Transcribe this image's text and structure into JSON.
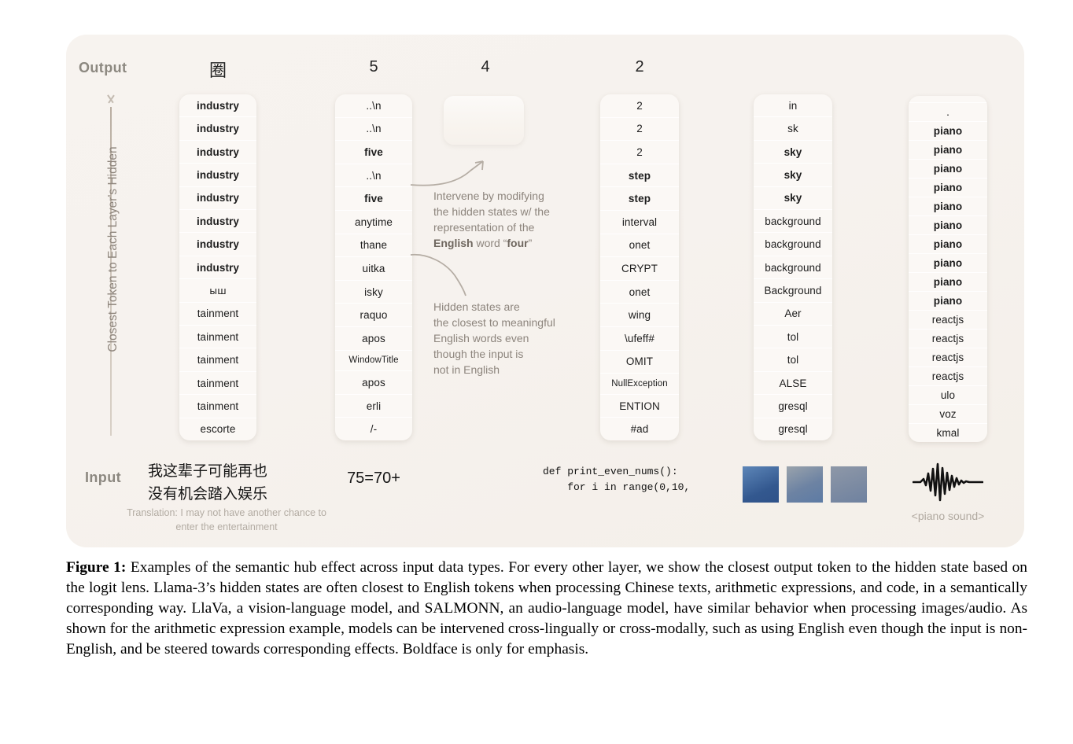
{
  "figure": {
    "output_row_label": "Output",
    "input_row_label": "Input",
    "y_axis_label": "Closest Token to Each Layer's Hidden",
    "columns": [
      {
        "id": "chinese",
        "output_header": "圈",
        "tokens": [
          {
            "text": "industry",
            "bold": true
          },
          {
            "text": "industry",
            "bold": true
          },
          {
            "text": "industry",
            "bold": true
          },
          {
            "text": "industry",
            "bold": true
          },
          {
            "text": "industry",
            "bold": true
          },
          {
            "text": "industry",
            "bold": true
          },
          {
            "text": "industry",
            "bold": true
          },
          {
            "text": "industry",
            "bold": true
          },
          {
            "text": "ыш",
            "bold": false
          },
          {
            "text": "tainment",
            "bold": false
          },
          {
            "text": "tainment",
            "bold": false
          },
          {
            "text": "tainment",
            "bold": false
          },
          {
            "text": "tainment",
            "bold": false
          },
          {
            "text": "tainment",
            "bold": false
          },
          {
            "text": "escorte",
            "bold": false
          }
        ],
        "input_text": "我这辈子可能再也\n没有机会踏入娱乐",
        "input_translation": "Translation: I may not have another chance to enter the entertainment"
      },
      {
        "id": "arithmetic",
        "output_header": "5",
        "tokens": [
          {
            "text": "..\\n",
            "bold": false
          },
          {
            "text": "..\\n",
            "bold": false
          },
          {
            "text": "five",
            "bold": true
          },
          {
            "text": "..\\n",
            "bold": false
          },
          {
            "text": "five",
            "bold": true
          },
          {
            "text": "anytime",
            "bold": false
          },
          {
            "text": "thane",
            "bold": false
          },
          {
            "text": "uitka",
            "bold": false
          },
          {
            "text": "isky",
            "bold": false
          },
          {
            "text": "raquo",
            "bold": false
          },
          {
            "text": "apos",
            "bold": false
          },
          {
            "text": "WindowTitle",
            "bold": false
          },
          {
            "text": "apos",
            "bold": false
          },
          {
            "text": "erli",
            "bold": false
          },
          {
            "text": "/-",
            "bold": false
          }
        ],
        "input_text": "75=70+"
      },
      {
        "id": "intervened",
        "output_header": "4",
        "tokens": [],
        "input_text": ""
      },
      {
        "id": "code",
        "output_header": "2",
        "tokens": [
          {
            "text": "2",
            "bold": false
          },
          {
            "text": "2",
            "bold": false
          },
          {
            "text": "2",
            "bold": false
          },
          {
            "text": "step",
            "bold": true
          },
          {
            "text": "step",
            "bold": true
          },
          {
            "text": "interval",
            "bold": false
          },
          {
            "text": "onet",
            "bold": false
          },
          {
            "text": "CRYPT",
            "bold": false
          },
          {
            "text": "onet",
            "bold": false
          },
          {
            "text": "wing",
            "bold": false
          },
          {
            "text": "\\ufeff#",
            "bold": false
          },
          {
            "text": "OMIT",
            "bold": false
          },
          {
            "text": "NullException",
            "bold": false
          },
          {
            "text": "ENTION",
            "bold": false
          },
          {
            "text": "#ad",
            "bold": false
          }
        ],
        "input_text": "def print_even_nums():\n    for i in range(0,10,"
      },
      {
        "id": "image",
        "output_header": "",
        "tokens": [
          {
            "text": "in",
            "bold": false
          },
          {
            "text": "sk",
            "bold": false
          },
          {
            "text": "sky",
            "bold": true
          },
          {
            "text": "sky",
            "bold": true
          },
          {
            "text": "sky",
            "bold": true
          },
          {
            "text": "background",
            "bold": false
          },
          {
            "text": "background",
            "bold": false
          },
          {
            "text": "background",
            "bold": false
          },
          {
            "text": "Background",
            "bold": false
          },
          {
            "text": "Aer",
            "bold": false
          },
          {
            "text": "tol",
            "bold": false
          },
          {
            "text": "tol",
            "bold": false
          },
          {
            "text": "ALSE",
            "bold": false
          },
          {
            "text": "gresql",
            "bold": false
          },
          {
            "text": "gresql",
            "bold": false
          }
        ],
        "input_text": ""
      },
      {
        "id": "audio",
        "output_header": "",
        "tokens": [
          {
            "text": "",
            "bold": false
          },
          {
            "text": ".",
            "bold": false
          },
          {
            "text": "piano",
            "bold": true
          },
          {
            "text": "piano",
            "bold": true
          },
          {
            "text": "piano",
            "bold": true
          },
          {
            "text": "piano",
            "bold": true
          },
          {
            "text": "piano",
            "bold": true
          },
          {
            "text": "piano",
            "bold": true
          },
          {
            "text": "piano",
            "bold": true
          },
          {
            "text": "piano",
            "bold": true
          },
          {
            "text": "piano",
            "bold": true
          },
          {
            "text": "piano",
            "bold": true
          },
          {
            "text": "reactjs",
            "bold": false
          },
          {
            "text": "reactjs",
            "bold": false
          },
          {
            "text": "reactjs",
            "bold": false
          },
          {
            "text": "reactjs",
            "bold": false
          },
          {
            "text": "ulo",
            "bold": false
          },
          {
            "text": "voz",
            "bold": false
          },
          {
            "text": "kmal",
            "bold": false
          }
        ],
        "input_text": "<piano sound>"
      }
    ],
    "annotations": {
      "intervene": {
        "line1": "Intervene by modifying",
        "line2": "the hidden states w/ the",
        "line3": "representation of the",
        "line4_pre": "",
        "line4_bold1": "English",
        "line4_mid": " word “",
        "line4_bold2": "four",
        "line4_post": "”"
      },
      "hidden_states": {
        "line1": "Hidden states are",
        "line2": "the closest to meaningful",
        "line3": "English words even",
        "line4": "though the input is",
        "line5": "not in English"
      }
    }
  },
  "caption": {
    "label": "Figure 1:",
    "body": " Examples of the semantic hub effect across input data types. For every other layer, we show the closest output token to the hidden state based on the logit lens. Llama-3’s hidden states are often closest to English tokens when processing Chinese texts, arithmetic expressions, and code, in a semantically corresponding way. LlaVa, a vision-language model, and SALMONN, an audio-language model, have similar behavior when processing images/audio. As shown for the arithmetic expression example, models can be intervened cross-lingually or cross-modally, such as using English even though the input is non-English, and be steered towards corresponding effects. Boldface is only for emphasis."
  },
  "colors": {
    "panel_bg": "#f6f2ee",
    "token_bg": "#fbf8f5",
    "muted_text": "#8d857d",
    "label_text": "#8c8880",
    "image_blue": "#33588f"
  }
}
